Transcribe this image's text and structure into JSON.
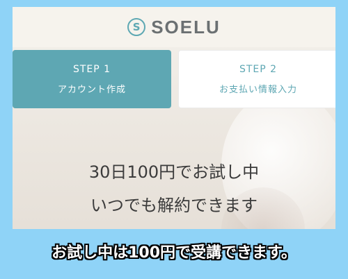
{
  "brand": {
    "logo_text": "SOELU",
    "logo_glyph": "S"
  },
  "steps": [
    {
      "number": "STEP 1",
      "label": "アカウント作成",
      "active": true
    },
    {
      "number": "STEP 2",
      "label": "お支払い情報入力",
      "active": false
    }
  ],
  "headline": {
    "line1": "30日100円でお試し中",
    "line2": "いつでも解約できます"
  },
  "caption": "お試し中は100円で受講できます。",
  "colors": {
    "accent": "#5ea7b3",
    "frame": "#8fd3f7",
    "text": "#3b3b3b"
  }
}
